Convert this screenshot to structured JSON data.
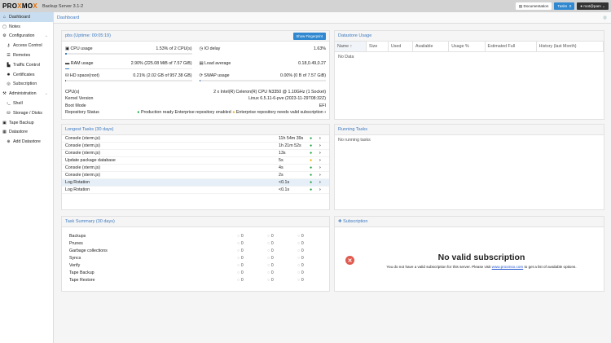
{
  "topbar": {
    "logo": "PROXMOX",
    "product": "Backup Server 3.1-2",
    "docs": "Documentation",
    "tasks": "Tasks",
    "tasks_count": "0",
    "user": "root@pam"
  },
  "sidebar": {
    "items": [
      {
        "label": "Dashboard",
        "icon": "home-icon"
      },
      {
        "label": "Notes",
        "icon": "notes-icon"
      },
      {
        "label": "Configuration",
        "icon": "gears-icon"
      },
      {
        "label": "Access Control",
        "icon": "key-icon",
        "sub": true
      },
      {
        "label": "Remotes",
        "icon": "server-icon",
        "sub": true
      },
      {
        "label": "Traffic Control",
        "icon": "chart-icon",
        "sub": true
      },
      {
        "label": "Certificates",
        "icon": "certificate-icon",
        "sub": true
      },
      {
        "label": "Subscription",
        "icon": "support-icon",
        "sub": true
      },
      {
        "label": "Administration",
        "icon": "wrench-icon"
      },
      {
        "label": "Shell",
        "icon": "terminal-icon",
        "sub": true
      },
      {
        "label": "Storage / Disks",
        "icon": "hdd-icon",
        "sub": true
      },
      {
        "label": "Tape Backup",
        "icon": "tape-icon"
      },
      {
        "label": "Datastore",
        "icon": "database-icon"
      },
      {
        "label": "Add Datastore",
        "icon": "plus-circle-icon",
        "sub": true
      }
    ]
  },
  "breadcrumb": "Dashboard",
  "status": {
    "title": "pbs (Uptime: 00:05:19)",
    "fingerprint_button": "Show Fingerprint",
    "cpu_label": "CPU usage",
    "cpu_value": "1.53% of 2 CPU(s)",
    "cpu_pct": 1.53,
    "io_label": "IO delay",
    "io_value": "1.63%",
    "io_pct": 1.63,
    "ram_label": "RAM usage",
    "ram_value": "2.90% (225.08 MiB of 7.57 GiB)",
    "ram_pct": 2.9,
    "load_label": "Load average",
    "load_value": "0.18,0.49,0.27",
    "hd_label": "HD space(root)",
    "hd_value": "0.21% (2.02 GB of 957.38 GB)",
    "hd_pct": 0.21,
    "swap_label": "SWAP usage",
    "swap_value": "0.00% (0 B of 7.57 GiB)",
    "swap_pct": 0,
    "cpus_label": "CPU(s)",
    "cpus_value": "2 x Intel(R) Celeron(R) CPU N3350 @ 1.10GHz (1 Socket)",
    "kernel_label": "Kernel Version",
    "kernel_value": "Linux 6.5.11-6-pve (2023-11-29T08:32Z)",
    "boot_label": "Boot Mode",
    "boot_value": "EFI",
    "repo_label": "Repository Status",
    "repo_ok": "Production ready Enterprise repository enabled",
    "repo_warn": "Enterprise repository needs valid subscription"
  },
  "datastore": {
    "title": "Datastore Usage",
    "columns": [
      "Name ↑",
      "Size",
      "Used",
      "Available",
      "Usage %",
      "Estimated Full",
      "History (last Month)"
    ],
    "empty": "No Data"
  },
  "longest": {
    "title": "Longest Tasks (30 days)",
    "rows": [
      {
        "name": "Console (xterm.js)",
        "dur": "11h 54m 39s",
        "status": "ok"
      },
      {
        "name": "Console (xterm.js)",
        "dur": "1h 21m 52s",
        "status": "ok"
      },
      {
        "name": "Console (xterm.js)",
        "dur": "13s",
        "status": "ok"
      },
      {
        "name": "Update package database",
        "dur": "5s",
        "status": "warn"
      },
      {
        "name": "Console (xterm.js)",
        "dur": "4s",
        "status": "ok"
      },
      {
        "name": "Console (xterm.js)",
        "dur": "2s",
        "status": "ok"
      },
      {
        "name": "Log Rotation",
        "dur": "<0.1s",
        "status": "ok"
      },
      {
        "name": "Log Rotation",
        "dur": "<0.1s",
        "status": "ok"
      }
    ]
  },
  "running": {
    "title": "Running Tasks",
    "empty": "No running tasks"
  },
  "summary": {
    "title": "Task Summary (30 days)",
    "rows": [
      {
        "label": "Backups",
        "a": "0",
        "b": "0",
        "c": "0"
      },
      {
        "label": "Prunes",
        "a": "0",
        "b": "0",
        "c": "0"
      },
      {
        "label": "Garbage collections",
        "a": "0",
        "b": "0",
        "c": "0"
      },
      {
        "label": "Syncs",
        "a": "0",
        "b": "0",
        "c": "0"
      },
      {
        "label": "Verify",
        "a": "0",
        "b": "0",
        "c": "0"
      },
      {
        "label": "Tape Backup",
        "a": "0",
        "b": "0",
        "c": "0"
      },
      {
        "label": "Tape Restore",
        "a": "0",
        "b": "0",
        "c": "0"
      }
    ]
  },
  "subscription": {
    "title": "Subscription",
    "heading": "No valid subscription",
    "text_before": "You do not have a valid subscription for this server. Please visit",
    "link": "www.proxmox.com",
    "text_after": "to get a list of available options."
  }
}
